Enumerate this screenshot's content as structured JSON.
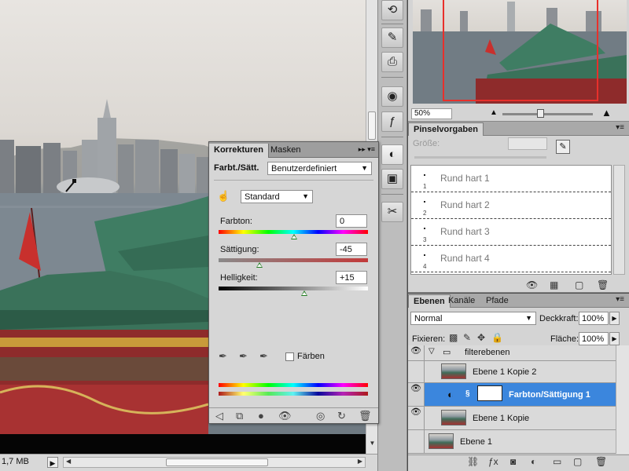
{
  "status": {
    "doc_size": "1,7 MB"
  },
  "navigator": {
    "zoom": "50%"
  },
  "brush_panel": {
    "tab": "Pinselvorgaben",
    "size_label": "Größe:",
    "brushes": [
      {
        "name": "Rund hart 1",
        "num": "1"
      },
      {
        "name": "Rund hart 2",
        "num": "2"
      },
      {
        "name": "Rund hart 3",
        "num": "3"
      },
      {
        "name": "Rund hart 4",
        "num": "4"
      }
    ]
  },
  "layers_panel": {
    "tabs": [
      "Ebenen",
      "Kanäle",
      "Pfade"
    ],
    "blend_mode": "Normal",
    "opacity_label": "Deckkraft:",
    "opacity": "100%",
    "lock_label": "Fixieren:",
    "fill_label": "Fläche:",
    "fill": "100%",
    "layers": [
      {
        "name": "filterebenen"
      },
      {
        "name": "Ebene 1 Kopie 2"
      },
      {
        "name": "Farbton/Sättigung 1"
      },
      {
        "name": "Ebene 1 Kopie"
      },
      {
        "name": "Ebene 1"
      }
    ]
  },
  "adjust_panel": {
    "tabs": [
      "Korrekturen",
      "Masken"
    ],
    "heading": "Farbt./Sätt.",
    "preset": "Benutzerdefiniert",
    "channel": "Standard",
    "hue_label": "Farbton:",
    "hue_value": "0",
    "sat_label": "Sättigung:",
    "sat_value": "-45",
    "light_label": "Helligkeit:",
    "light_value": "+15",
    "colorize_label": "Färben"
  }
}
